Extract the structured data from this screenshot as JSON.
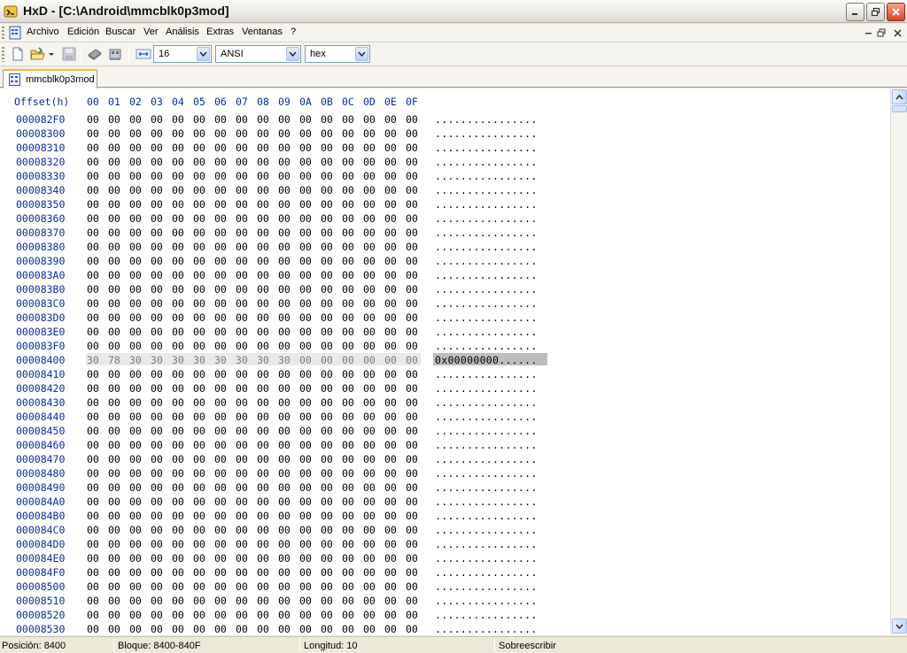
{
  "window": {
    "title": "HxD - [C:\\Android\\mmcblk0p3mod]",
    "minimize_symbol": "_",
    "restore_symbol": "❐",
    "close_symbol": "✕"
  },
  "menu": {
    "items": [
      "Archivo",
      "Edición",
      "Buscar",
      "Ver",
      "Análisis",
      "Extras",
      "Ventanas",
      "?"
    ],
    "mdi": {
      "minimize": "–",
      "restore": "❐",
      "close": "✕"
    }
  },
  "toolbar": {
    "bytes_per_row": "16",
    "charset": "ANSI",
    "offset_base": "hex"
  },
  "tab": {
    "label": "mmcblk0p3mod"
  },
  "editor": {
    "header_offset": "Offset(h)",
    "columns": [
      "00",
      "01",
      "02",
      "03",
      "04",
      "05",
      "06",
      "07",
      "08",
      "09",
      "0A",
      "0B",
      "0C",
      "0D",
      "0E",
      "0F"
    ],
    "rows": [
      {
        "offset": "000082F0",
        "bytes": "00 00 00 00 00 00 00 00 00 00 00 00 00 00 00 00",
        "text": "................"
      },
      {
        "offset": "00008300",
        "bytes": "00 00 00 00 00 00 00 00 00 00 00 00 00 00 00 00",
        "text": "................"
      },
      {
        "offset": "00008310",
        "bytes": "00 00 00 00 00 00 00 00 00 00 00 00 00 00 00 00",
        "text": "................"
      },
      {
        "offset": "00008320",
        "bytes": "00 00 00 00 00 00 00 00 00 00 00 00 00 00 00 00",
        "text": "................"
      },
      {
        "offset": "00008330",
        "bytes": "00 00 00 00 00 00 00 00 00 00 00 00 00 00 00 00",
        "text": "................"
      },
      {
        "offset": "00008340",
        "bytes": "00 00 00 00 00 00 00 00 00 00 00 00 00 00 00 00",
        "text": "................"
      },
      {
        "offset": "00008350",
        "bytes": "00 00 00 00 00 00 00 00 00 00 00 00 00 00 00 00",
        "text": "................"
      },
      {
        "offset": "00008360",
        "bytes": "00 00 00 00 00 00 00 00 00 00 00 00 00 00 00 00",
        "text": "................"
      },
      {
        "offset": "00008370",
        "bytes": "00 00 00 00 00 00 00 00 00 00 00 00 00 00 00 00",
        "text": "................"
      },
      {
        "offset": "00008380",
        "bytes": "00 00 00 00 00 00 00 00 00 00 00 00 00 00 00 00",
        "text": "................"
      },
      {
        "offset": "00008390",
        "bytes": "00 00 00 00 00 00 00 00 00 00 00 00 00 00 00 00",
        "text": "................"
      },
      {
        "offset": "000083A0",
        "bytes": "00 00 00 00 00 00 00 00 00 00 00 00 00 00 00 00",
        "text": "................"
      },
      {
        "offset": "000083B0",
        "bytes": "00 00 00 00 00 00 00 00 00 00 00 00 00 00 00 00",
        "text": "................"
      },
      {
        "offset": "000083C0",
        "bytes": "00 00 00 00 00 00 00 00 00 00 00 00 00 00 00 00",
        "text": "................"
      },
      {
        "offset": "000083D0",
        "bytes": "00 00 00 00 00 00 00 00 00 00 00 00 00 00 00 00",
        "text": "................"
      },
      {
        "offset": "000083E0",
        "bytes": "00 00 00 00 00 00 00 00 00 00 00 00 00 00 00 00",
        "text": "................"
      },
      {
        "offset": "000083F0",
        "bytes": "00 00 00 00 00 00 00 00 00 00 00 00 00 00 00 00",
        "text": "................"
      },
      {
        "offset": "00008400",
        "bytes": "30 78 30 30 30 30 30 30 30 30 00 00 00 00 00 00",
        "text": "0x00000000......",
        "selected": true
      },
      {
        "offset": "00008410",
        "bytes": "00 00 00 00 00 00 00 00 00 00 00 00 00 00 00 00",
        "text": "................"
      },
      {
        "offset": "00008420",
        "bytes": "00 00 00 00 00 00 00 00 00 00 00 00 00 00 00 00",
        "text": "................"
      },
      {
        "offset": "00008430",
        "bytes": "00 00 00 00 00 00 00 00 00 00 00 00 00 00 00 00",
        "text": "................"
      },
      {
        "offset": "00008440",
        "bytes": "00 00 00 00 00 00 00 00 00 00 00 00 00 00 00 00",
        "text": "................"
      },
      {
        "offset": "00008450",
        "bytes": "00 00 00 00 00 00 00 00 00 00 00 00 00 00 00 00",
        "text": "................"
      },
      {
        "offset": "00008460",
        "bytes": "00 00 00 00 00 00 00 00 00 00 00 00 00 00 00 00",
        "text": "................"
      },
      {
        "offset": "00008470",
        "bytes": "00 00 00 00 00 00 00 00 00 00 00 00 00 00 00 00",
        "text": "................"
      },
      {
        "offset": "00008480",
        "bytes": "00 00 00 00 00 00 00 00 00 00 00 00 00 00 00 00",
        "text": "................"
      },
      {
        "offset": "00008490",
        "bytes": "00 00 00 00 00 00 00 00 00 00 00 00 00 00 00 00",
        "text": "................"
      },
      {
        "offset": "000084A0",
        "bytes": "00 00 00 00 00 00 00 00 00 00 00 00 00 00 00 00",
        "text": "................"
      },
      {
        "offset": "000084B0",
        "bytes": "00 00 00 00 00 00 00 00 00 00 00 00 00 00 00 00",
        "text": "................"
      },
      {
        "offset": "000084C0",
        "bytes": "00 00 00 00 00 00 00 00 00 00 00 00 00 00 00 00",
        "text": "................"
      },
      {
        "offset": "000084D0",
        "bytes": "00 00 00 00 00 00 00 00 00 00 00 00 00 00 00 00",
        "text": "................"
      },
      {
        "offset": "000084E0",
        "bytes": "00 00 00 00 00 00 00 00 00 00 00 00 00 00 00 00",
        "text": "................"
      },
      {
        "offset": "000084F0",
        "bytes": "00 00 00 00 00 00 00 00 00 00 00 00 00 00 00 00",
        "text": "................"
      },
      {
        "offset": "00008500",
        "bytes": "00 00 00 00 00 00 00 00 00 00 00 00 00 00 00 00",
        "text": "................"
      },
      {
        "offset": "00008510",
        "bytes": "00 00 00 00 00 00 00 00 00 00 00 00 00 00 00 00",
        "text": "................"
      },
      {
        "offset": "00008520",
        "bytes": "00 00 00 00 00 00 00 00 00 00 00 00 00 00 00 00",
        "text": "................"
      },
      {
        "offset": "00008530",
        "bytes": "00 00 00 00 00 00 00 00 00 00 00 00 00 00 00 00",
        "text": "................"
      }
    ]
  },
  "status": {
    "position": "Posición: 8400",
    "block": "Bloque: 8400-840F",
    "length": "Longitud: 10",
    "mode": "Sobreescribir"
  },
  "colors": {
    "offset_blue": "#0B2C9E",
    "selection_hex_bg": "#E9E9E9",
    "selection_text_bg": "#BDBDBD",
    "tab_accent": "#F9B238",
    "close_red": "#D4472A"
  }
}
